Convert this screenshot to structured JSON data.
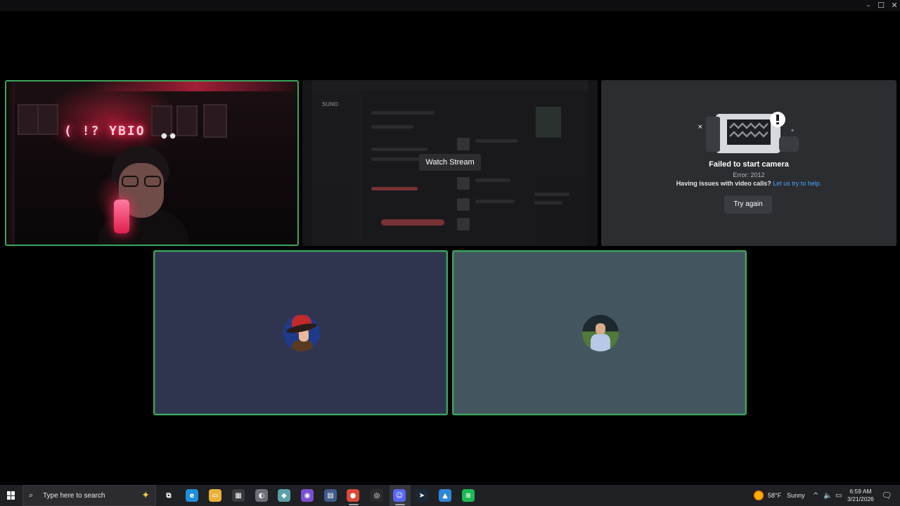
{
  "window": {
    "minimize_glyph": "–",
    "maximize_glyph": "☐",
    "close_glyph": "✕"
  },
  "tiles": {
    "camera": {
      "neon_text": "( !? YBIO",
      "neon_small": "● ●"
    },
    "stream": {
      "watch_label": "Watch Stream",
      "preview_logo": "SUNO"
    },
    "error": {
      "title": "Failed to start camera",
      "code": "Error: 2012",
      "help_text": "Having issues with video calls?",
      "help_link": "Let us try to help.",
      "try_again_label": "Try again"
    },
    "participants": [
      {
        "avatar": "hat-character-avatar",
        "bg": "#30354f"
      },
      {
        "avatar": "person-photo-avatar",
        "bg": "#435660"
      }
    ],
    "speaking_color": "#3ba55d"
  },
  "taskbar": {
    "search_placeholder": "Type here to search",
    "apps": [
      {
        "name": "task-view-icon",
        "glyph": "⧉",
        "color": "#202124"
      },
      {
        "name": "edge-icon",
        "glyph": "e",
        "color": "#1f8fd6"
      },
      {
        "name": "file-explorer-icon",
        "glyph": "▭",
        "color": "#e8b23a"
      },
      {
        "name": "calculator-icon",
        "glyph": "▦",
        "color": "#3a3a3e"
      },
      {
        "name": "app-icon-1",
        "glyph": "◐",
        "color": "#6b6f7a"
      },
      {
        "name": "app-icon-2",
        "glyph": "◆",
        "color": "#5aa0a8"
      },
      {
        "name": "app-icon-3",
        "glyph": "◉",
        "color": "#7a4fd0"
      },
      {
        "name": "app-icon-4",
        "glyph": "▤",
        "color": "#3f5a8a"
      },
      {
        "name": "chrome-icon",
        "glyph": "●",
        "color": "#d94a38"
      },
      {
        "name": "obs-icon",
        "glyph": "◎",
        "color": "#2a2a2e"
      },
      {
        "name": "discord-icon",
        "glyph": "☺",
        "color": "#5865f2"
      },
      {
        "name": "steam-icon",
        "glyph": "➤",
        "color": "#1b2838"
      },
      {
        "name": "app-icon-5",
        "glyph": "▲",
        "color": "#2f86d8"
      },
      {
        "name": "spotify-icon",
        "glyph": "≋",
        "color": "#1db954"
      }
    ],
    "weather": {
      "temp": "58°F",
      "condition": "Sunny"
    },
    "tray": {
      "chevron": "^",
      "volume": "🔈",
      "network": "▭"
    },
    "clock": {
      "time": "6:59 AM",
      "date": "3/21/2026"
    },
    "notification_glyph": "🗨"
  }
}
